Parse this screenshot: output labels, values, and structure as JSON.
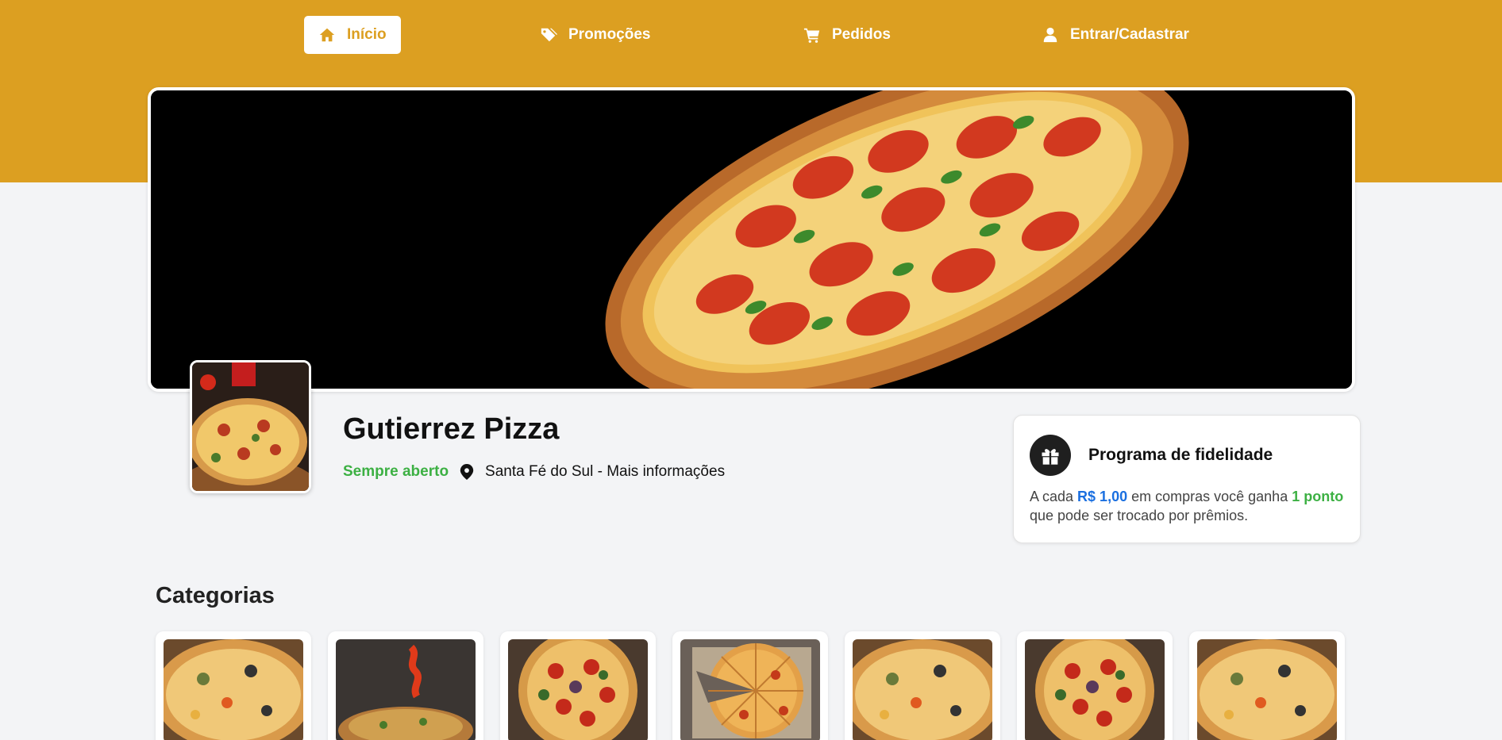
{
  "nav": {
    "items": [
      {
        "label": "Início",
        "icon": "home-icon",
        "active": true
      },
      {
        "label": "Promoções",
        "icon": "tags-icon",
        "active": false
      },
      {
        "label": "Pedidos",
        "icon": "cart-icon",
        "active": false
      },
      {
        "label": "Entrar/Cadastrar",
        "icon": "user-icon",
        "active": false
      }
    ]
  },
  "store": {
    "name": "Gutierrez Pizza",
    "status": "Sempre aberto",
    "location": "Santa Fé do Sul - Mais informações"
  },
  "loyalty": {
    "title": "Programa de fidelidade",
    "text_prefix": "A cada ",
    "amount": "R$ 1,00",
    "text_middle": " em compras você ganha ",
    "points": "1 ponto",
    "text_suffix": " que pode ser trocado por prêmios."
  },
  "categories": {
    "title": "Categorias",
    "items": [
      {
        "image": "pizza-slice-photo"
      },
      {
        "image": "pizza-peppers-photo"
      },
      {
        "image": "pepperoni-pizza-photo"
      },
      {
        "image": "sliced-pizza-photo"
      },
      {
        "image": "pizza-slice-photo"
      },
      {
        "image": "pepperoni-pizza-photo"
      },
      {
        "image": "pizza-slice-photo"
      }
    ]
  },
  "colors": {
    "brand": "#dc9f21",
    "open_status": "#3cb043",
    "amount_highlight": "#1a6fe0",
    "background": "#f3f4f6"
  }
}
